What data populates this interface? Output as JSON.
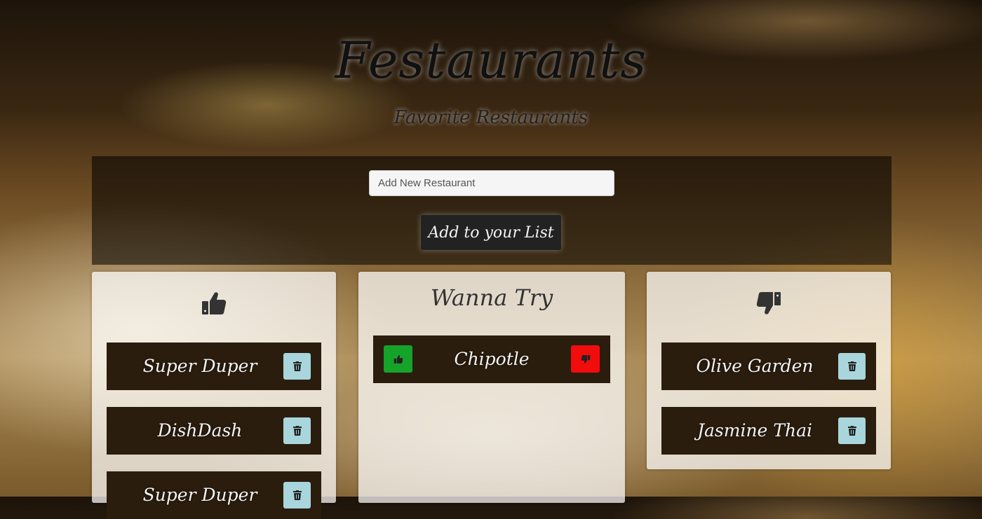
{
  "header": {
    "title": "Festaurants",
    "subtitle": "Favorite Restaurants"
  },
  "add_form": {
    "placeholder": "Add New Restaurant",
    "button_label": "Add to your List"
  },
  "columns": {
    "liked": {
      "icon": "thumbs-up-icon",
      "items": [
        "Super Duper",
        "DishDash",
        "Super Duper"
      ]
    },
    "wanna_try": {
      "heading": "Wanna Try",
      "items": [
        "Chipotle"
      ]
    },
    "disliked": {
      "icon": "thumbs-down-icon",
      "items": [
        "Olive Garden",
        "Jasmine Thai"
      ]
    }
  },
  "colors": {
    "like": "#15a32a",
    "dislike": "#f20d0d",
    "trash": "#a9d6dc",
    "item_bg": "#2a1d0e"
  }
}
